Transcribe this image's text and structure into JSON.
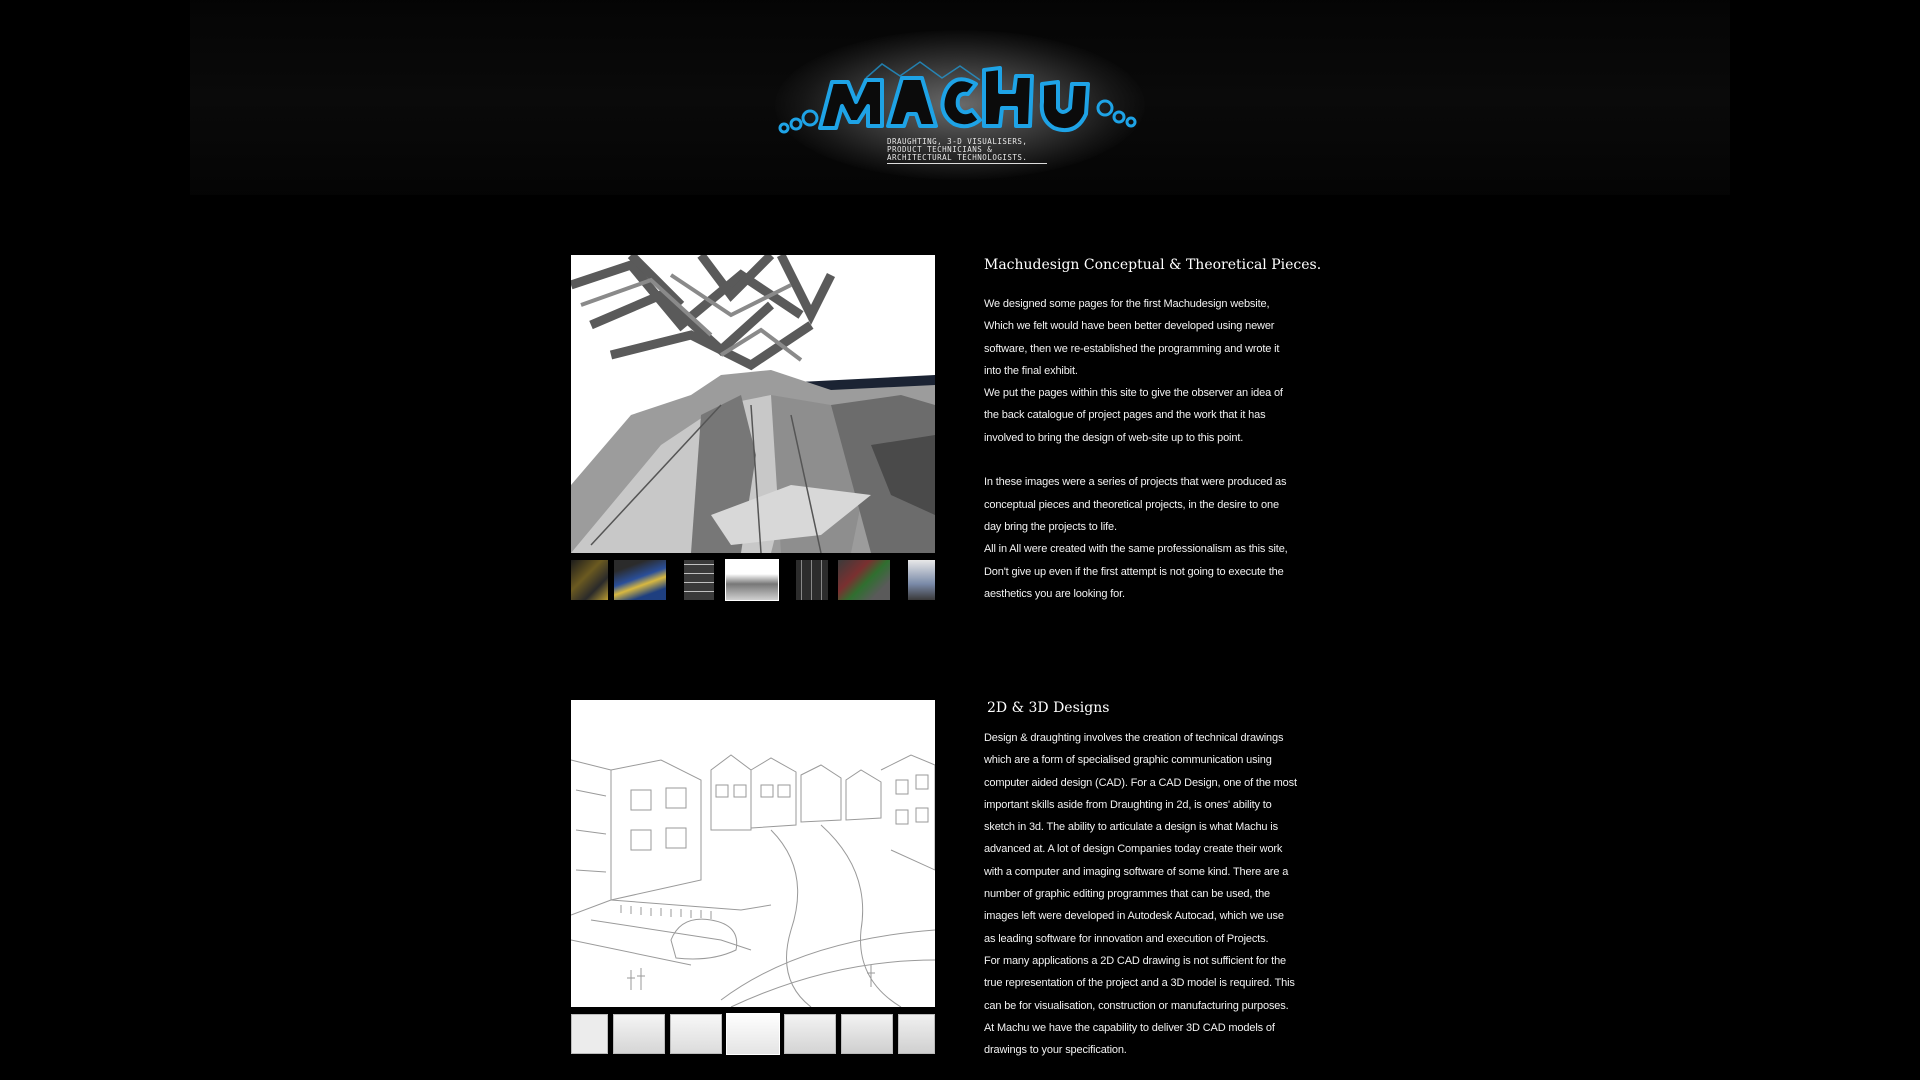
{
  "logo": {
    "wordmark": "MACHU",
    "subtitle_lines": [
      "DRAUGHTING, 3-D VISUALISERS,",
      "PRODUCT TECHNICIANS &",
      "ARCHITECTURAL TECHNOLOGISTS."
    ]
  },
  "sections": [
    {
      "heading": "Machudesign Conceptual & Theoretical Pieces.",
      "lines": [
        "We designed some pages for the first Machudesign website,",
        "Which we felt would have been better developed using newer",
        "software, then we re-established the programming and wrote it",
        "into the final exhibit.",
        "We put the pages within this site to give the observer an idea of",
        "the back catalogue of project pages and the work that it has",
        "involved to bring the design of web-site up to this point.",
        "",
        "In these images were a series of projects that were produced as",
        "conceptual pieces and theoretical projects, in the desire to one",
        "day bring the projects to life.",
        "All in All were created with the same professionalism as this site,",
        "Don't give up even if the first attempt is not going to execute the",
        "aesthetics you are looking for."
      ],
      "thumbnail_count": 7,
      "active_thumbnail": 4
    },
    {
      "heading": "2D & 3D Designs",
      "lines": [
        "Design & draughting involves the creation of technical drawings",
        "which are a form of specialised graphic communication using",
        "computer aided design (CAD). For a CAD Design, one of the most",
        "important skills aside from Draughting in 2d, is ones' ability to",
        "sketch in 3d. The ability to articulate a design is what Machu is",
        "advanced at. A lot of design Companies today create their work",
        "with a computer and imaging software of some kind. There are a",
        "number of graphic editing programmes that can be used, the",
        "images left were developed in Autodesk Autocad, which we use",
        "as leading software for innovation and execution of Projects.",
        "For many applications a 2D CAD drawing is not sufficient for the",
        "true representation of the project and a 3D model is required. This",
        "can be for visualisation, construction or manufacturing purposes.",
        "At Machu we have the capability to deliver 3D CAD models of",
        "drawings to your specification."
      ],
      "thumbnail_count": 7,
      "active_thumbnail": 4
    }
  ],
  "colors": {
    "background": "#000000",
    "logo_blue": "#1ea3e6",
    "text": "#f2f2f2"
  }
}
